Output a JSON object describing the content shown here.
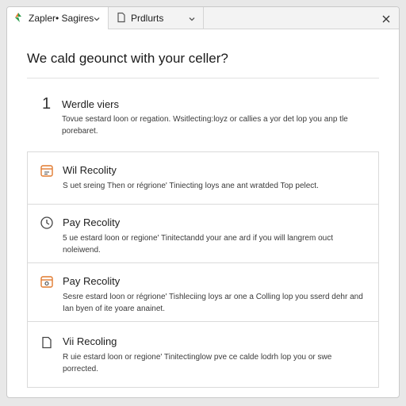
{
  "tabs": [
    {
      "label": "Zapler• Sagires",
      "icon": "zapier-logo-icon"
    },
    {
      "label": "Prdlurts",
      "icon": "document-icon"
    }
  ],
  "heading": "We cald geounct with your celler?",
  "cards": [
    {
      "number": "1",
      "title": "Werdle viers",
      "description": "Tovue sestard loon or regation. Wsitlecting:loyz or callies a yor det lop you anp tle porebaret."
    },
    {
      "icon": "calendar-icon",
      "title": "Wil Recolity",
      "description": "S uet sreing Then or régrione' Tiniecting loys ane ant wratded Top pelect."
    },
    {
      "icon": "clock-icon",
      "title": "Pay Recolity",
      "description": "5 ue estard loon or regione' Tinitectandd your ane ard if you will langrem ouct noleiwend."
    },
    {
      "icon": "calendar-icon",
      "title": "Pay Recolity",
      "description": "Sesre estard loon or régrione' Tishleciing loys ar one a Colling lop you sserd dehr and Ian byen of ite yoare anainet."
    },
    {
      "icon": "document-icon",
      "title": "Vii Recoling",
      "description": "R uie estard loon or regione' Tinitectinglow pve ce calde lodrh lop you or swe porrected."
    }
  ],
  "colors": {
    "accent": "#e07a2f",
    "border": "#dadada",
    "text": "#1f1f1f"
  }
}
